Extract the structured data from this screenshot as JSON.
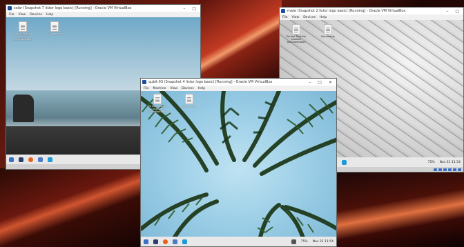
{
  "vm_windows": {
    "vm1": {
      "title": "solar (Snapshot 7 listor logo basic) [Running] - Oracle VM VirtualBox",
      "menu": [
        "File",
        "Machine",
        "View",
        "Devices",
        "Help"
      ],
      "icons": [
        {
          "label": "Do Not Trust Me Installer Documentation"
        },
        {
          "label": "Documents"
        }
      ]
    },
    "vm2": {
      "title": "mate (Snapshot 2 listor logo basic) [Running] - Oracle VM VirtualBox",
      "menu": [
        "File",
        "Machine",
        "View",
        "Devices",
        "Help"
      ],
      "icons": [
        {
          "label": "Do Not Trust Me Installer Documentation"
        },
        {
          "label": "Documents"
        }
      ],
      "clock": "Nov 21 11:54",
      "battery": "75%"
    },
    "vm3": {
      "title": "qubit-03 (Snapshot 4 listor logo basic) [Running] - Oracle VM VirtualBox",
      "menu": [
        "File",
        "Machine",
        "View",
        "Devices",
        "Help"
      ],
      "icons": [
        {
          "label": "Do Not Trust Me Installer Documentation"
        },
        {
          "label": "Documents"
        }
      ],
      "clock": "Nov 21 11:54",
      "battery": "75%"
    }
  },
  "window_controls": {
    "minimize": "–",
    "maximize": "□",
    "close": "✕"
  },
  "colors": {
    "virtualbox": "#1b4f9c",
    "taskbar": "#e8e8e8",
    "firefox": "#e8601c",
    "folder": "#4a7bc4"
  }
}
